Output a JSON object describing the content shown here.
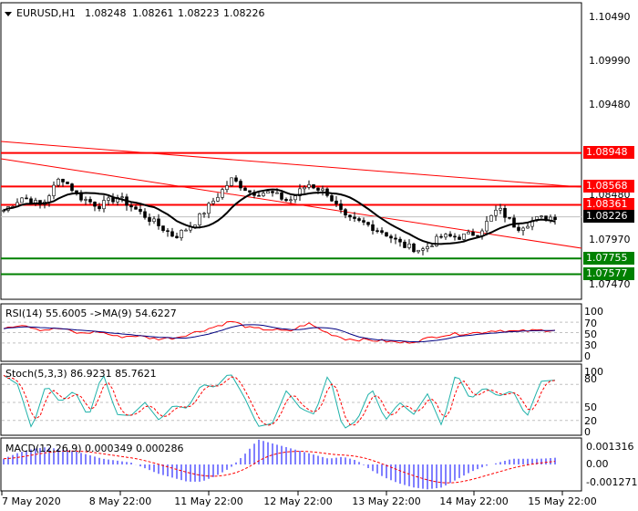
{
  "header": {
    "symbol": "EURUSD,H1",
    "open": "1.08248",
    "high": "1.08261",
    "low": "1.08223",
    "close": "1.08226"
  },
  "price_axis": {
    "ticks": [
      "1.10490",
      "1.09990",
      "1.09480",
      "1.08480",
      "1.07970",
      "1.07470"
    ]
  },
  "levels": [
    {
      "value": "1.08948",
      "color": "#ff0000"
    },
    {
      "value": "1.08568",
      "color": "#ff0000"
    },
    {
      "value": "1.08361",
      "color": "#ff0000"
    },
    {
      "value": "1.07755",
      "color": "#008000"
    },
    {
      "value": "1.07577",
      "color": "#008000"
    }
  ],
  "current_price": "1.08226",
  "time_axis": [
    "7 May 2020",
    "8 May 22:00",
    "11 May 22:00",
    "12 May 22:00",
    "13 May 22:00",
    "14 May 22:00",
    "15 May 22:00"
  ],
  "rsi": {
    "label": "RSI(14) 55.6005  ->MA(9) 54.6227",
    "ticks": [
      "100",
      "70",
      "50",
      "30",
      "0"
    ]
  },
  "stoch": {
    "label": "Stoch(5,3,3) 86.9231 85.7621",
    "ticks": [
      "100",
      "80",
      "50",
      "20",
      "0"
    ]
  },
  "macd": {
    "label": "MACD(12,26,9) 0.000349 0.000286",
    "ticks": [
      "0.001316",
      "0.00",
      "-0.001271"
    ]
  },
  "chart_data": {
    "type": "candlestick",
    "close_path": [
      1.083,
      1.0845,
      1.0835,
      1.0868,
      1.0845,
      1.0835,
      1.0845,
      1.083,
      1.0815,
      1.08,
      1.0815,
      1.084,
      1.0865,
      1.085,
      1.085,
      1.084,
      1.086,
      1.085,
      1.082,
      1.0815,
      1.0805,
      1.079,
      1.0785,
      1.08,
      1.08,
      1.0805,
      1.0832,
      1.081,
      1.082,
      1.0823
    ],
    "rsi_path": [
      60,
      66,
      55,
      58,
      48,
      52,
      42,
      44,
      38,
      40,
      50,
      60,
      72,
      58,
      56,
      52,
      68,
      50,
      38,
      36,
      34,
      30,
      36,
      45,
      48,
      50,
      55,
      52,
      54,
      55.6
    ],
    "stoch_path": [
      95,
      80,
      5,
      80,
      50,
      70,
      25,
      100,
      30,
      28,
      50,
      20,
      45,
      40,
      80,
      75,
      100,
      60,
      10,
      15,
      70,
      40,
      30,
      100,
      5,
      20,
      75,
      20,
      50,
      30,
      65,
      10,
      100,
      55,
      75,
      60,
      70,
      25,
      85,
      87
    ],
    "macd_hist": [
      3,
      6,
      8,
      9,
      8,
      7,
      5,
      3,
      2,
      1,
      -2,
      -5,
      -7,
      -9,
      -9,
      -6,
      -2,
      5,
      13,
      11,
      9,
      7,
      5,
      3,
      4,
      2,
      -3,
      -7,
      -10,
      -12,
      -13,
      -12,
      -8,
      -4,
      -1,
      1,
      3,
      3,
      3,
      3.5
    ]
  }
}
